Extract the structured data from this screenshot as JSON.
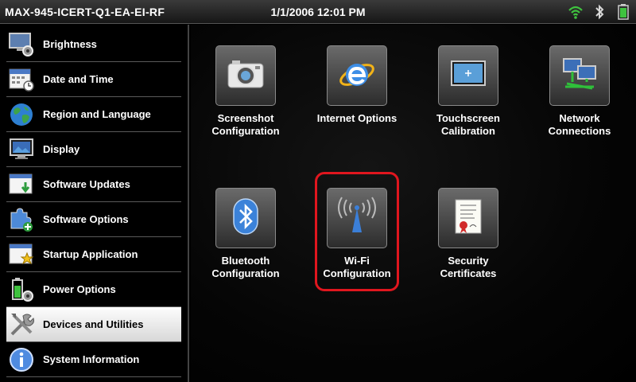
{
  "status_bar": {
    "device_name": "MAX-945-ICERT-Q1-EA-EI-RF",
    "datetime": "1/1/2006 12:01 PM",
    "icons": [
      "wifi-signal-icon",
      "bluetooth-icon",
      "battery-icon"
    ]
  },
  "sidebar": {
    "items": [
      {
        "label": "Brightness",
        "icon": "brightness-icon"
      },
      {
        "label": "Date and Time",
        "icon": "calendar-clock-icon"
      },
      {
        "label": "Region and Language",
        "icon": "globe-icon"
      },
      {
        "label": "Display",
        "icon": "display-icon"
      },
      {
        "label": "Software Updates",
        "icon": "software-update-icon"
      },
      {
        "label": "Software Options",
        "icon": "puzzle-icon"
      },
      {
        "label": "Startup Application",
        "icon": "startup-star-icon"
      },
      {
        "label": "Power Options",
        "icon": "power-battery-icon"
      },
      {
        "label": "Devices and Utilities",
        "icon": "tools-icon",
        "selected": true
      },
      {
        "label": "System Information",
        "icon": "info-icon"
      }
    ]
  },
  "main": {
    "tiles": [
      {
        "line1": "Screenshot",
        "line2": "Configuration",
        "icon": "camera-icon"
      },
      {
        "line1": "Internet Options",
        "line2": "",
        "icon": "internet-explorer-icon"
      },
      {
        "line1": "Touchscreen",
        "line2": "Calibration",
        "icon": "touchscreen-icon"
      },
      {
        "line1": "Network",
        "line2": "Connections",
        "icon": "network-icon"
      },
      {
        "line1": "Bluetooth",
        "line2": "Configuration",
        "icon": "bluetooth-icon"
      },
      {
        "line1": "Wi-Fi",
        "line2": "Configuration",
        "icon": "wifi-antenna-icon",
        "highlighted": true
      },
      {
        "line1": "Security",
        "line2": "Certificates",
        "icon": "certificate-icon"
      }
    ]
  },
  "colors": {
    "highlight": "#e0161e",
    "selected_bg": "#f0f0f0",
    "background": "#000000"
  }
}
